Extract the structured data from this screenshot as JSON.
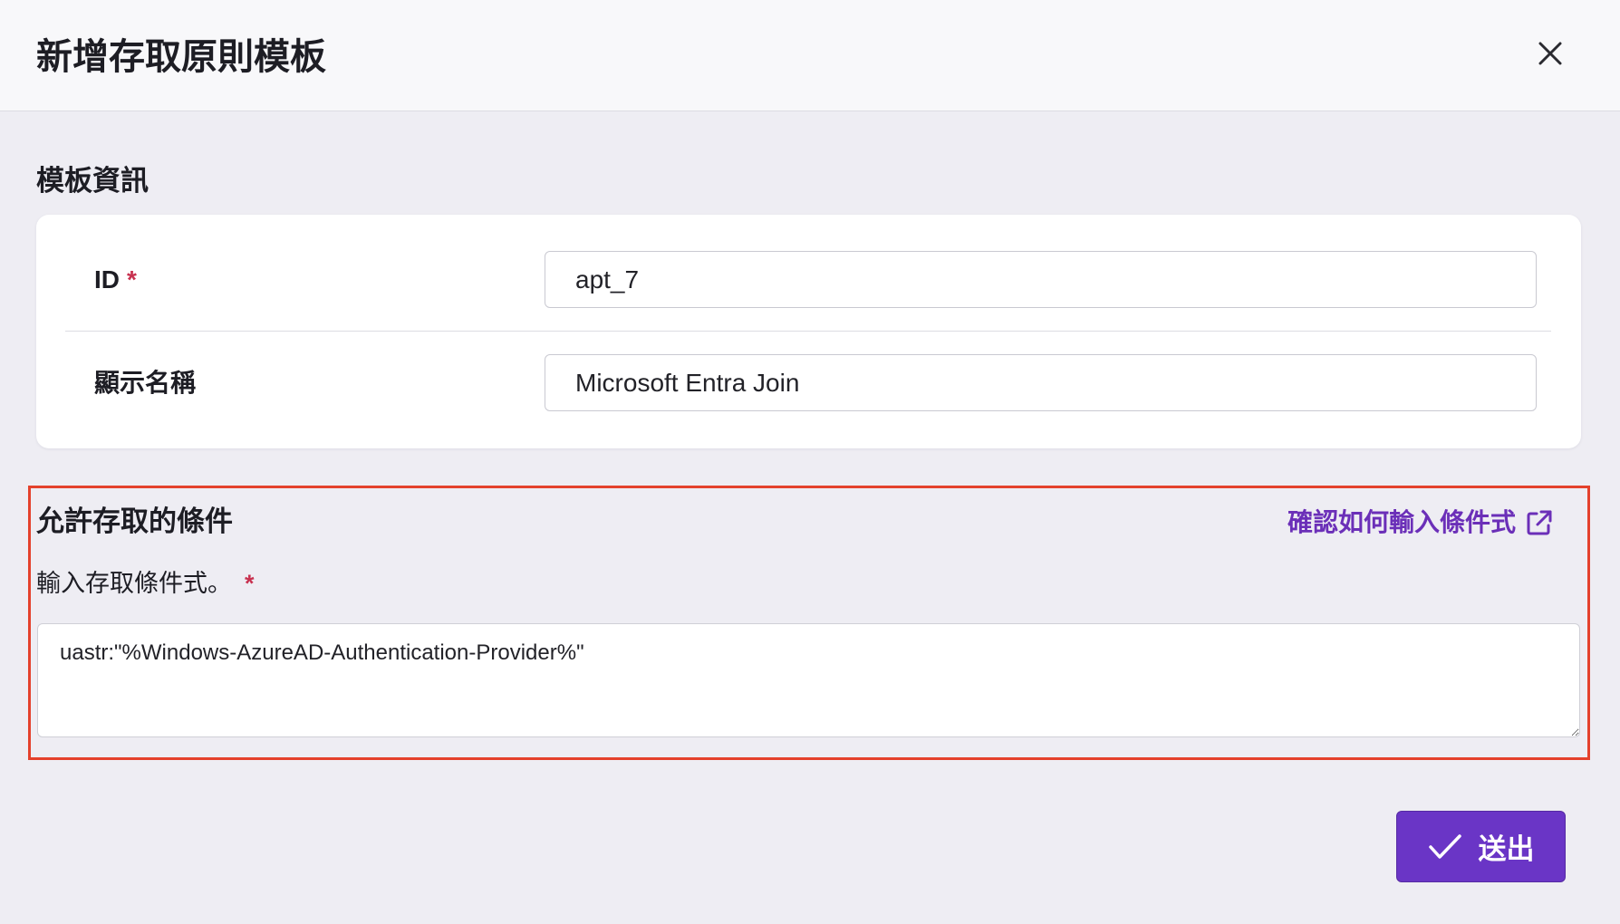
{
  "dialog": {
    "title": "新增存取原則模板",
    "close_icon": "close-icon"
  },
  "template_info": {
    "heading": "模板資訊",
    "fields": [
      {
        "label": "ID",
        "required": "*",
        "value": "apt_7"
      },
      {
        "label": "顯示名稱",
        "value": "Microsoft Entra Join"
      }
    ]
  },
  "conditions": {
    "heading": "允許存取的條件",
    "help_link": "確認如何輸入條件式",
    "help_link_icon": "external-link-icon",
    "field_label": "輸入存取條件式。",
    "required": "*",
    "value": "uastr:\"%Windows-AzureAD-Authentication-Provider%\""
  },
  "footer": {
    "submit_label": "送出",
    "submit_icon": "check-icon"
  },
  "colors": {
    "accent": "#6a35c6",
    "link": "#6b2fb8",
    "required": "#c8314f",
    "highlight_border": "#e4412c"
  }
}
